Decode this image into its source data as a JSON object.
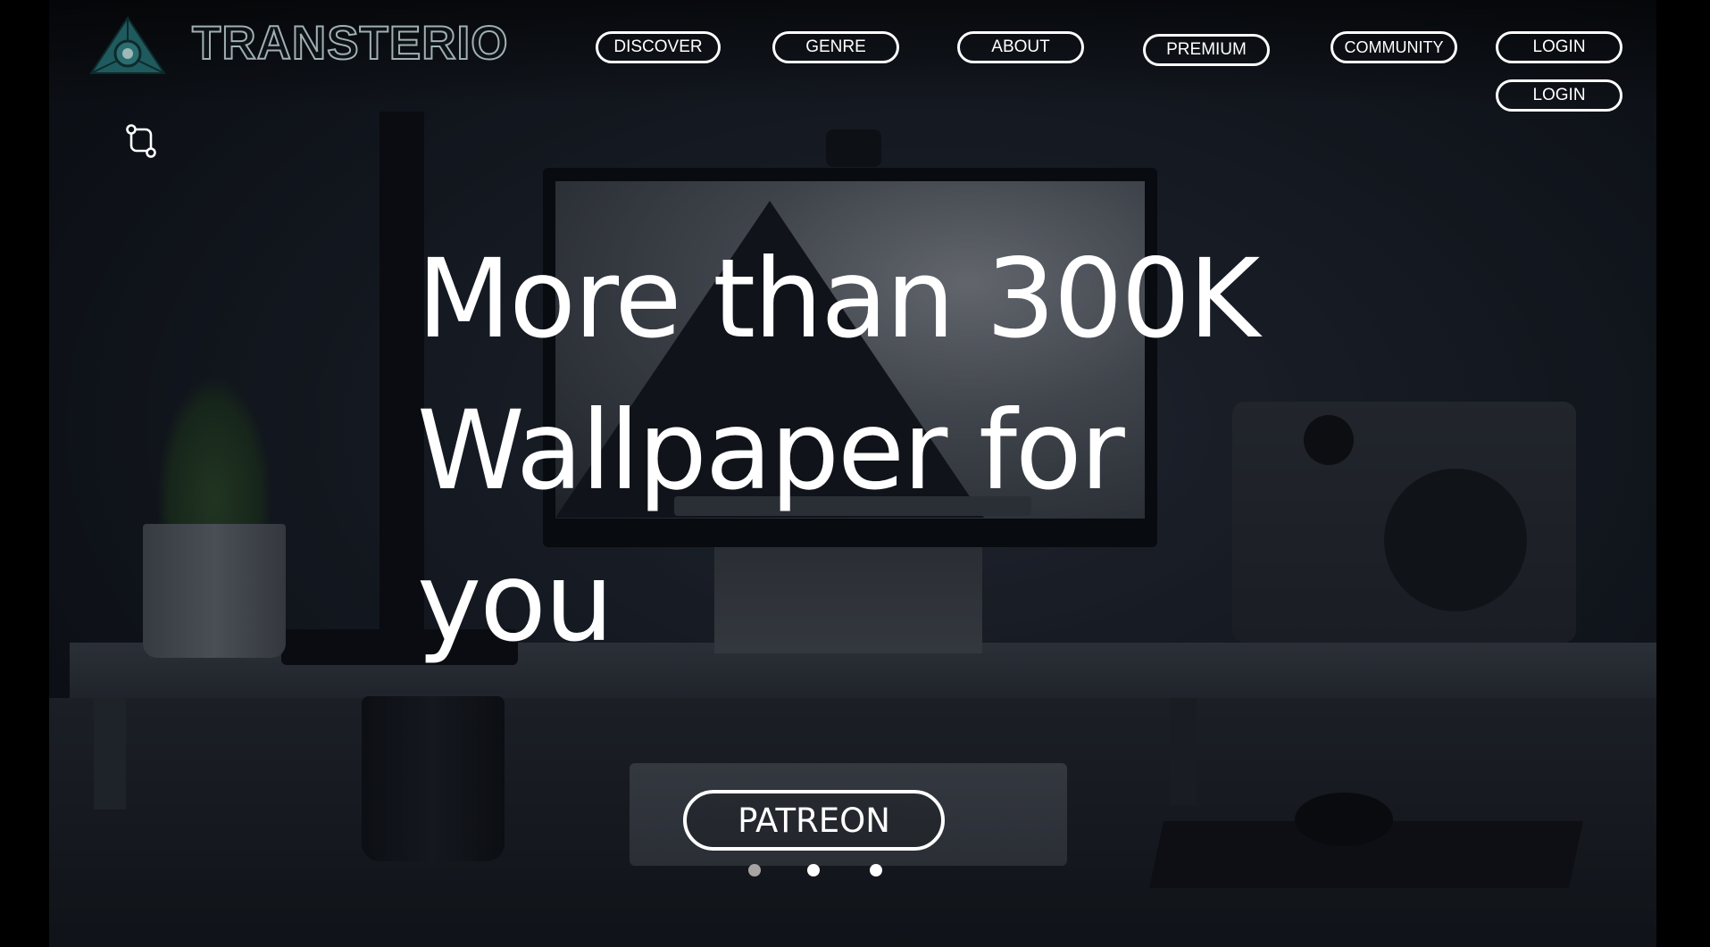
{
  "brand": {
    "name": "TRANSTERIO"
  },
  "nav": {
    "discover": "DISCOVER",
    "genre": "GENRE",
    "about": "ABOUT",
    "premium": "PREMIUM",
    "community": "COMMUNITY",
    "login_primary": "LOGIN",
    "login_secondary": "LOGIN"
  },
  "hero": {
    "headline_line1": "More than 300K",
    "headline_line2": "Wallpaper for",
    "headline_line3": "you",
    "cta_label": "PATREON"
  },
  "carousel": {
    "slide_count": 3,
    "active_index": 0
  },
  "icons": {
    "logo": "triangle-logo-icon",
    "switch": "route-switch-icon"
  },
  "colors": {
    "background": "#000000",
    "text": "#ffffff",
    "logo_teal": "#1f5a5e",
    "dot_active": "#a9a4a4",
    "dot_inactive": "#ffffff"
  }
}
